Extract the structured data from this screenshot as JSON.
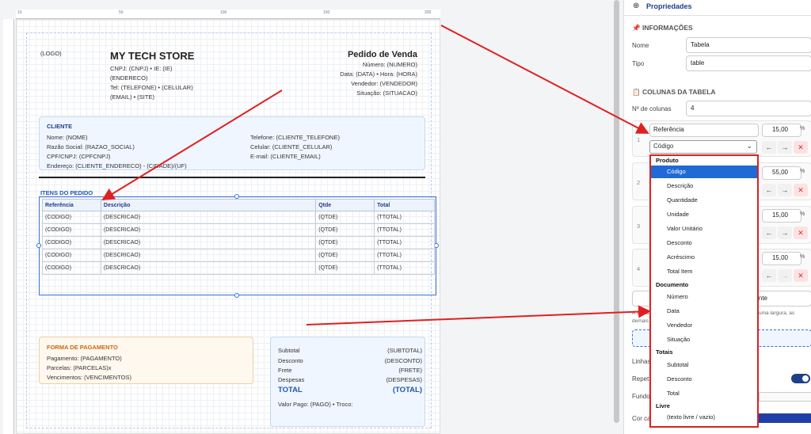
{
  "document": {
    "logo": "(LOGO)",
    "store_name": "MY TECH STORE",
    "store_lines": [
      "CNPJ: (CNPJ) • IE: (IE)",
      "(ENDERECO)",
      "Tel: (TELEFONE) • (CELULAR)",
      "(EMAIL) • (SITE)"
    ],
    "doc_title": "Pedido de Venda",
    "doc_lines": [
      "Número: (NUMERO)",
      "Data: (DATA) • Hora: (HORA)",
      "Vendedor: (VENDEDOR)",
      "Situação: (SITUACAO)"
    ],
    "ruler_labels": [
      "10",
      "50",
      "100",
      "150",
      "200"
    ],
    "client": {
      "title": "CLIENTE",
      "left_lines": [
        "Nome: (NOME)",
        "Razão Social: (RAZAO_SOCIAL)",
        "CPF/CNPJ: (CPFCNPJ)",
        "Endereço: (CLIENTE_ENDERECO) - (CIDADE)/(UF)"
      ],
      "right_lines": [
        "Telefone: (CLIENTE_TELEFONE)",
        "Celular: (CLIENTE_CELULAR)",
        "E-mail: (CLIENTE_EMAIL)"
      ]
    },
    "items_title": "ITENS DO PEDIDO",
    "table": {
      "headers": [
        "Referência",
        "Descrição",
        "Qtde",
        "Total"
      ],
      "rows": [
        [
          "(CODIGO)",
          "(DESCRICAO)",
          "(QTDE)",
          "(TTOTAL)"
        ],
        [
          "(CODIGO)",
          "(DESCRICAO)",
          "(QTDE)",
          "(TTOTAL)"
        ],
        [
          "(CODIGO)",
          "(DESCRICAO)",
          "(QTDE)",
          "(TTOTAL)"
        ],
        [
          "(CODIGO)",
          "(DESCRICAO)",
          "(QTDE)",
          "(TTOTAL)"
        ],
        [
          "(CODIGO)",
          "(DESCRICAO)",
          "(QTDE)",
          "(TTOTAL)"
        ]
      ]
    },
    "payment": {
      "title": "FORMA DE PAGAMENTO",
      "lines": [
        "Pagamento: (PAGAMENTO)",
        "Parcelas: (PARCELAS)x",
        "Vencimentos: (VENCIMENTOS)"
      ]
    },
    "totals": {
      "rows": [
        {
          "label": "Subtotal",
          "value": "(SUBTOTAL)"
        },
        {
          "label": "Desconto",
          "value": "(DESCONTO)"
        },
        {
          "label": "Frete",
          "value": "(FRETE)"
        },
        {
          "label": "Despesas",
          "value": "(DESPESAS)"
        }
      ],
      "total_label": "TOTAL",
      "total_value": "(TOTAL)",
      "paid_line": "Valor Pago: (PAGO) • Troco:"
    }
  },
  "panel": {
    "title": "Propriedades",
    "info_title": "INFORMAÇÕES",
    "name_label": "Nome",
    "name_value": "Tabela",
    "type_label": "Tipo",
    "type_value": "table",
    "columns_title": "COLUNAS DA TABELA",
    "col_count_label": "Nº de colunas",
    "col_count_value": "4",
    "columns": [
      {
        "num": "1",
        "header": "Referência",
        "width": "15,00",
        "field": "Código"
      },
      {
        "num": "2",
        "width": "55,00"
      },
      {
        "num": "3",
        "width": "15,00"
      },
      {
        "num": "4",
        "width": "15,00"
      }
    ],
    "percent": "%",
    "partial_right_text": "nte",
    "note_left": "A soma",
    "note_right": "uma largura, as",
    "note_left2": "demais",
    "labels_partial": [
      "Linhas",
      "Repet",
      "Fundo",
      "Cor ca"
    ],
    "dropdown": {
      "groups": [
        {
          "name": "Produto",
          "items": [
            "Código",
            "Descrição",
            "Quantidade",
            "Unidade",
            "Valor Unitário",
            "Desconto",
            "Acréscimo",
            "Total Item"
          ]
        },
        {
          "name": "Documento",
          "items": [
            "Número",
            "Data",
            "Vendedor",
            "Situação"
          ]
        },
        {
          "name": "Totais",
          "items": [
            "Subtotal",
            "Desconto",
            "Total"
          ]
        },
        {
          "name": "Livre",
          "items": [
            "(texto livre / vazio)"
          ]
        }
      ],
      "selected": "Código"
    }
  },
  "colors": {
    "accent": "#1f56b0",
    "annotation": "#e02020",
    "selected": "#1f6ad6"
  }
}
